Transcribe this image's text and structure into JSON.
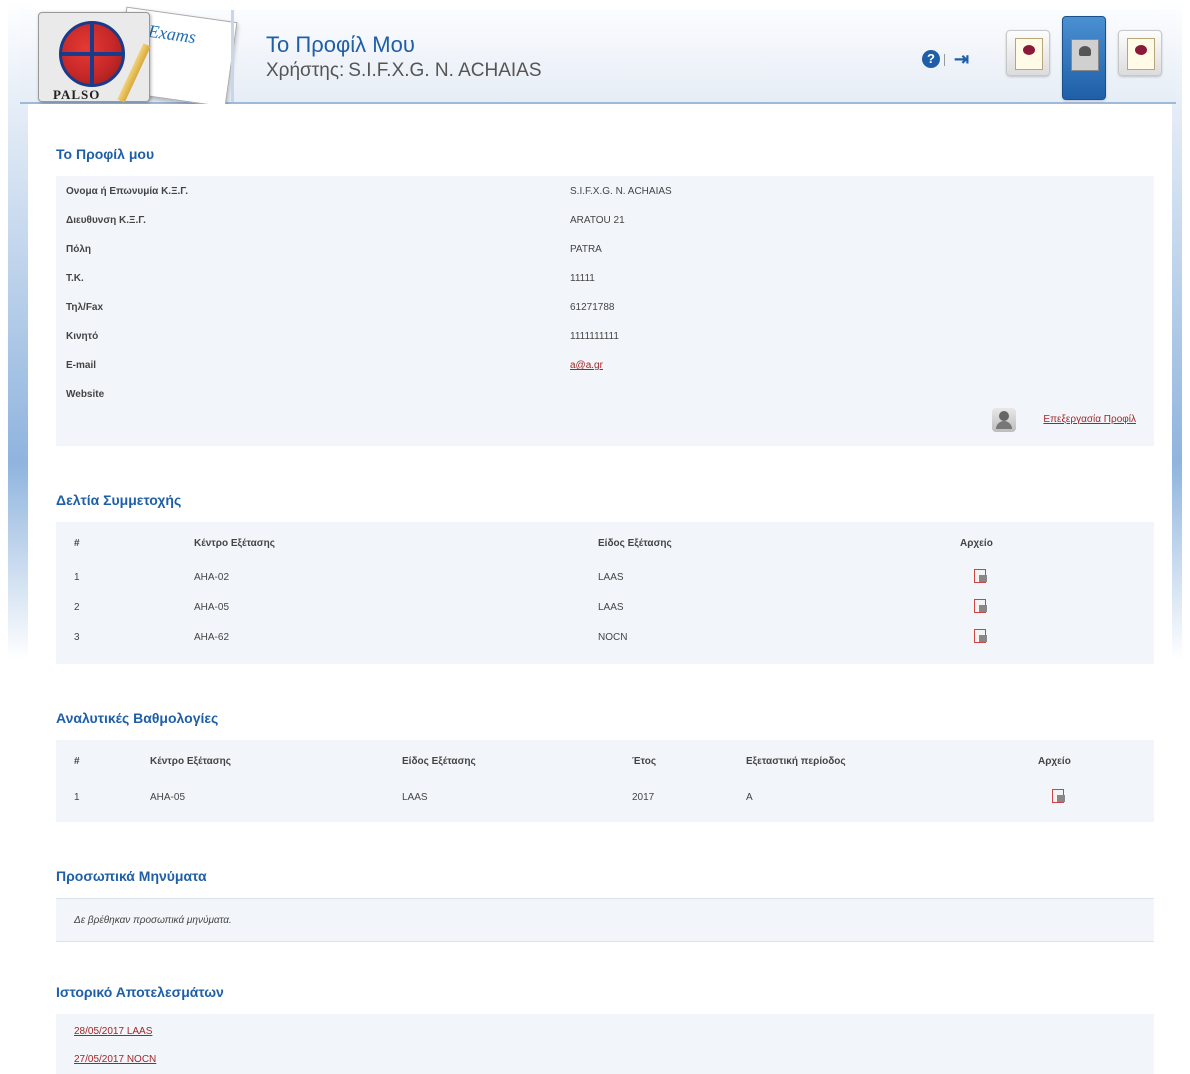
{
  "header": {
    "logo_text": "PALSO",
    "logo_exams": "Exams",
    "title": "Το Προφίλ Μου",
    "user_label": "Χρήστης:",
    "user_name": "S.I.F.X.G. N. ACHAIAS",
    "icons": [
      "help-icon",
      "logout-icon",
      "certificate-icon",
      "profile-icon",
      "diploma-icon"
    ]
  },
  "profile": {
    "title": "Το Προφίλ μου",
    "rows": [
      {
        "label": "Ονομα ή Επωνυμία Κ.Ξ.Γ.",
        "value": "S.I.F.X.G. N. ACHAIAS"
      },
      {
        "label": "Διευθυνση Κ.Ξ.Γ.",
        "value": "ARATOU 21"
      },
      {
        "label": "Πόλη",
        "value": "PATRA"
      },
      {
        "label": "T.K.",
        "value": "11111"
      },
      {
        "label": "Τηλ/Fax",
        "value": "61271788"
      },
      {
        "label": "Κινητό",
        "value": "1111111111"
      },
      {
        "label": "E-mail",
        "value": "a@a.gr"
      },
      {
        "label": "Website",
        "value": ""
      }
    ],
    "edit_label": "Επεξεργασία Προφίλ"
  },
  "participation": {
    "title": "Δελτία Συμμετοχής",
    "headers": [
      "#",
      "Κέντρο Εξέτασης",
      "Είδος Εξέτασης",
      "Αρχείο"
    ],
    "rows": [
      {
        "num": "1",
        "center": "AHA-02",
        "type": "LAAS"
      },
      {
        "num": "2",
        "center": "AHA-05",
        "type": "LAAS"
      },
      {
        "num": "3",
        "center": "AHA-62",
        "type": "NOCN"
      }
    ]
  },
  "grades": {
    "title": "Αναλυτικές Βαθμολογίες",
    "headers": [
      "#",
      "Κέντρο Εξέτασης",
      "Είδος Εξέτασης",
      "Έτος",
      "Εξεταστική περίοδος",
      "Αρχείο"
    ],
    "rows": [
      {
        "num": "1",
        "center": "AHA-05",
        "type": "LAAS",
        "year": "2017",
        "period": "A"
      }
    ]
  },
  "messages": {
    "title": "Προσωπικά Μηνύματα",
    "empty_text": "Δε βρέθηκαν προσωπικά μηνύματα."
  },
  "history": {
    "title": "Ιστορικό Αποτελεσμάτων",
    "links": [
      "28/05/2017 LAAS",
      "27/05/2017 NOCN"
    ]
  }
}
